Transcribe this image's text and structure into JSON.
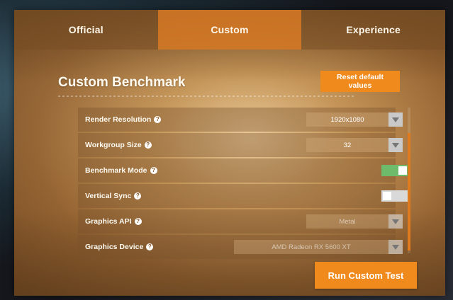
{
  "tabs": [
    {
      "label": "Official",
      "active": false
    },
    {
      "label": "Custom",
      "active": true
    },
    {
      "label": "Experience",
      "active": false
    }
  ],
  "header": {
    "title": "Custom Benchmark",
    "reset_label": "Reset default values"
  },
  "settings": [
    {
      "label": "Render Resolution",
      "type": "select",
      "value": "1920x1080",
      "enabled": true
    },
    {
      "label": "Workgroup Size",
      "type": "select",
      "value": "32",
      "enabled": true
    },
    {
      "label": "Benchmark Mode",
      "type": "toggle",
      "on": true
    },
    {
      "label": "Vertical Sync",
      "type": "toggle",
      "on": false
    },
    {
      "label": "Graphics API",
      "type": "select",
      "value": "Metal",
      "enabled": false
    },
    {
      "label": "Graphics Device",
      "type": "select",
      "value": "AMD Radeon RX 5600 XT",
      "enabled": false
    }
  ],
  "help_glyph": "?",
  "run_label": "Run Custom Test",
  "colors": {
    "accent": "#f08a1c",
    "toggle_on": "#6dbb6b",
    "toggle_off": "#d9d9d9"
  }
}
